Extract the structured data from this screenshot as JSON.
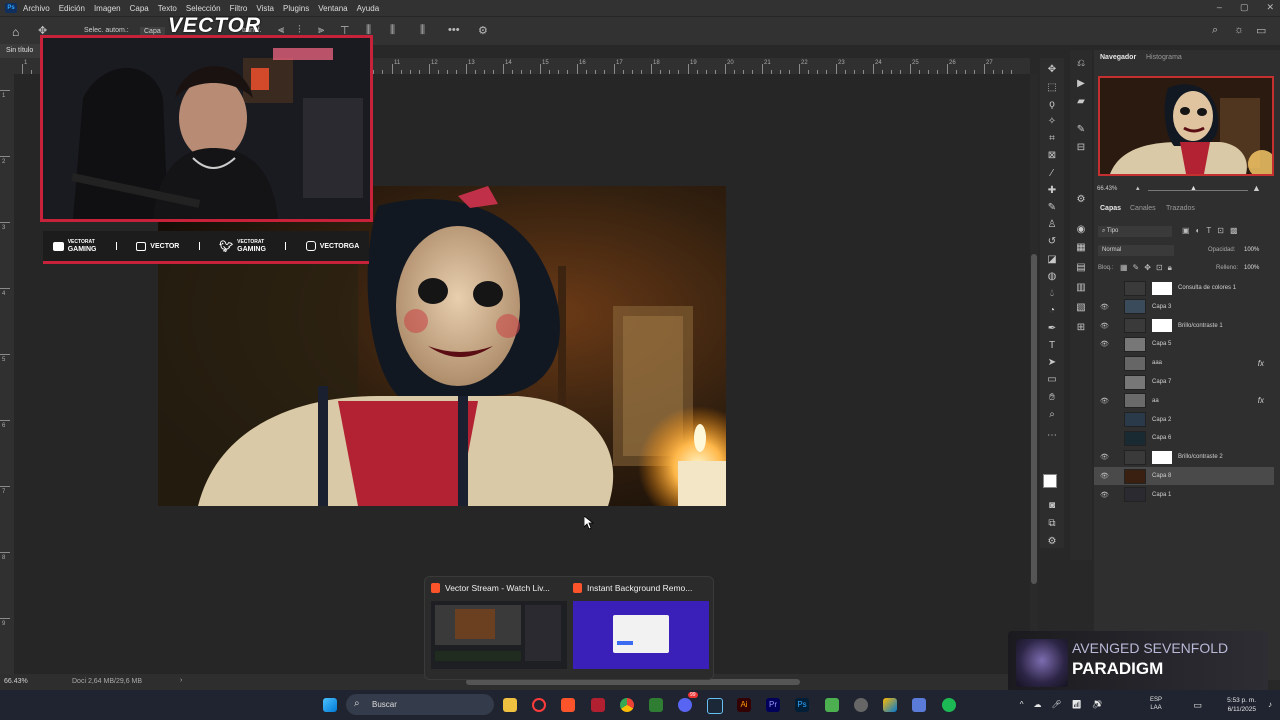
{
  "menu": {
    "app_logo": "Ps",
    "items": [
      "Archivo",
      "Edición",
      "Imagen",
      "Capa",
      "Texto",
      "Selección",
      "Filtro",
      "Vista",
      "Plugins",
      "Ventana",
      "Ayuda"
    ]
  },
  "options_bar": {
    "auto_select_label": "Selec. autom.:",
    "layer_dropdown": "Capa",
    "transform_label": "transf."
  },
  "document": {
    "tab_title": "Sin título",
    "zoom": "66.43%",
    "doc_info": "Doci 2,64 MB/29,6 MB"
  },
  "ruler": {
    "numbers": [
      "1",
      "2",
      "3",
      "4",
      "5",
      "6",
      "7",
      "8",
      "9",
      "10",
      "11",
      "12",
      "13",
      "14",
      "15",
      "16",
      "17",
      "18",
      "19",
      "20",
      "21",
      "22",
      "23",
      "24",
      "25",
      "26",
      "27"
    ]
  },
  "overlay": {
    "streamer_logo": "VECTOR",
    "socials": [
      {
        "icon": "youtube-icon",
        "line1": "VECTORAT",
        "line2": "GAMING"
      },
      {
        "icon": "twitch-icon",
        "line1": "VECTOR",
        "line2": ""
      },
      {
        "icon": "twitter-icon",
        "line1": "VECTORAT",
        "line2": "GAMING"
      },
      {
        "icon": "instagram-icon",
        "line1": "VECTORGA",
        "line2": ""
      }
    ]
  },
  "panels": {
    "nav_tabs": [
      "Navegador",
      "Histograma"
    ],
    "nav_zoom": "66.43%",
    "layer_tabs": [
      "Capas",
      "Canales",
      "Trazados"
    ],
    "filter_label": "Tipo",
    "blend_mode": "Normal",
    "opacity_label": "Opacidad:",
    "opacity_value": "100%",
    "lock_label": "Bloq.:",
    "fill_label": "Relleno:",
    "fill_value": "100%",
    "layers": [
      {
        "name": "Consulta de colores 1",
        "visible": false,
        "type": "adjust",
        "selected": false,
        "fx": false
      },
      {
        "name": "Capa 3",
        "visible": true,
        "type": "pixel",
        "selected": false,
        "fx": false
      },
      {
        "name": "Brillo/contraste 1",
        "visible": true,
        "type": "adjust",
        "selected": false,
        "fx": false
      },
      {
        "name": "Capa 5",
        "visible": true,
        "type": "pixel",
        "selected": false,
        "fx": false
      },
      {
        "name": "aaa",
        "visible": false,
        "type": "pixel",
        "selected": false,
        "fx": true
      },
      {
        "name": "Capa 7",
        "visible": false,
        "type": "pixel",
        "selected": false,
        "fx": false
      },
      {
        "name": "aa",
        "visible": true,
        "type": "pixel",
        "selected": false,
        "fx": true
      },
      {
        "name": "Capa 2",
        "visible": false,
        "type": "pixel",
        "selected": false,
        "fx": false
      },
      {
        "name": "Capa 6",
        "visible": false,
        "type": "pixel",
        "selected": false,
        "fx": false
      },
      {
        "name": "Brillo/contraste 2",
        "visible": true,
        "type": "adjust",
        "selected": false,
        "fx": false
      },
      {
        "name": "Capa 8",
        "visible": true,
        "type": "pixel",
        "selected": true,
        "fx": false
      },
      {
        "name": "Capa 1",
        "visible": true,
        "type": "pixel",
        "selected": false,
        "fx": false
      }
    ]
  },
  "taskbar_previews": [
    {
      "title": "Vector Stream - Watch Liv..."
    },
    {
      "title": "Instant Background Remo..."
    }
  ],
  "now_playing": {
    "artist": "AVENGED SEVENFOLD",
    "song": "PARADIGM"
  },
  "taskbar": {
    "search_placeholder": "Buscar",
    "lang_line1": "ESP",
    "lang_line2": "LAA",
    "time": "5:53 p. m.",
    "date": "6/11/2025",
    "notification_badge": "99"
  },
  "colors": {
    "accent_red": "#c8223a",
    "ps_blue": "#31a8ff"
  }
}
